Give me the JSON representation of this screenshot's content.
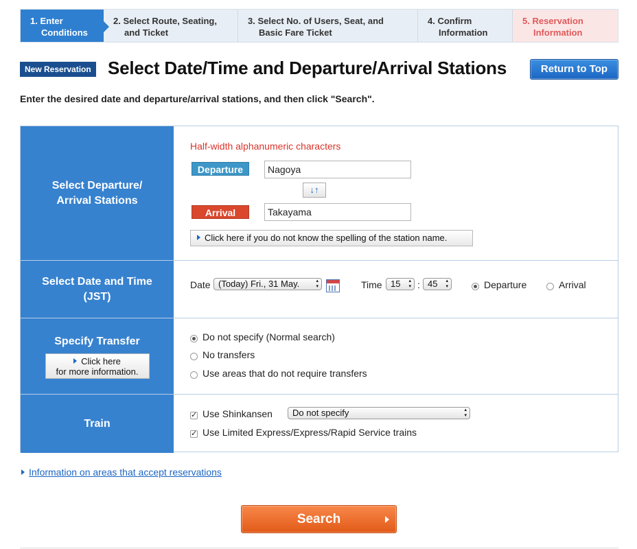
{
  "steps": [
    {
      "line1": "1. Enter",
      "line2": "Conditions"
    },
    {
      "line1": "2. Select Route, Seating,",
      "line2": "and Ticket"
    },
    {
      "line1": "3. Select No. of Users, Seat, and",
      "line2": "Basic Fare Ticket"
    },
    {
      "line1": "4. Confirm",
      "line2": "Information"
    },
    {
      "line1": "5. Reservation",
      "line2": "Information"
    }
  ],
  "header": {
    "badge": "New Reservation",
    "title": "Select Date/Time and Departure/Arrival Stations",
    "return_button": "Return to Top"
  },
  "instruction": "Enter the desired date and departure/arrival stations, and then click \"Search\".",
  "stations": {
    "head_line1": "Select Departure/",
    "head_line2": "Arrival Stations",
    "hint": "Half-width alphanumeric characters",
    "departure_label": "Departure",
    "departure_value": "Nagoya",
    "swap_icon": "↓↑",
    "arrival_label": "Arrival",
    "arrival_value": "Takayama",
    "spelling_button": "Click here if you do not know the spelling of the station name."
  },
  "datetime": {
    "head_line1": "Select Date and Time",
    "head_line2": "(JST)",
    "date_label": "Date",
    "date_value": "(Today) Fri., 31 May.",
    "time_label": "Time",
    "hour": "15",
    "colon": ":",
    "minute": "45",
    "option_departure": "Departure",
    "option_arrival": "Arrival"
  },
  "transfer": {
    "head": "Specify Transfer",
    "more_line1": "Click here",
    "more_line2": "for more information.",
    "options": [
      "Do not specify (Normal search)",
      "No transfers",
      "Use areas that do not require transfers"
    ]
  },
  "train": {
    "head": "Train",
    "shinkansen": "Use Shinkansen",
    "shinkansen_select": "Do not specify",
    "limited": "Use Limited Express/Express/Rapid Service trains"
  },
  "info_link": "Information on areas that accept reservations",
  "search_button": "Search"
}
